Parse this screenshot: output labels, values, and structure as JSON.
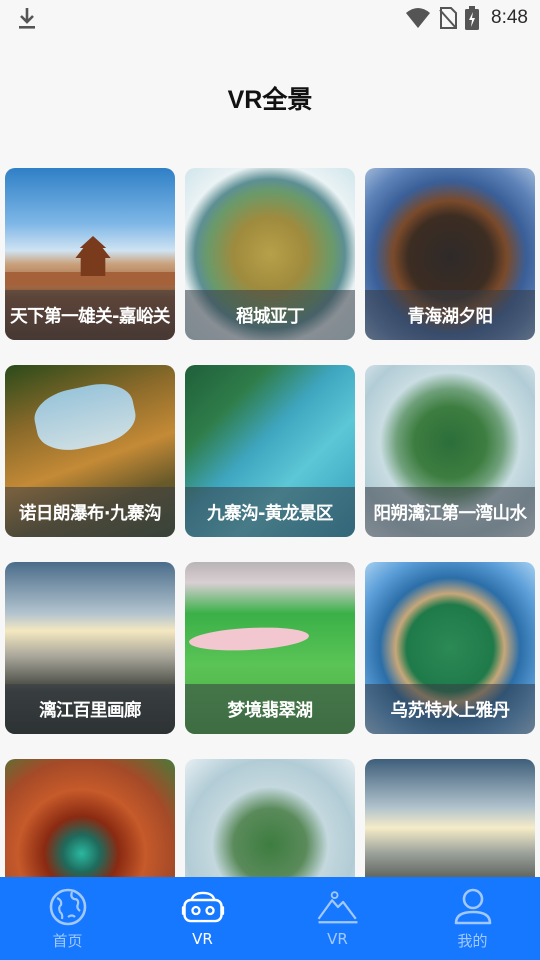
{
  "status_bar": {
    "time": "8:48"
  },
  "header": {
    "title": "VR全景"
  },
  "cards": [
    {
      "title": "天下第一雄关-嘉峪关"
    },
    {
      "title": "稻城亚丁"
    },
    {
      "title": "青海湖夕阳"
    },
    {
      "title": "诺日朗瀑布·九寨沟"
    },
    {
      "title": "九寨沟-黄龙景区"
    },
    {
      "title": "阳朔漓江第一湾山水"
    },
    {
      "title": "漓江百里画廊"
    },
    {
      "title": "梦境翡翠湖"
    },
    {
      "title": "乌苏特水上雅丹"
    },
    {
      "title": ""
    },
    {
      "title": ""
    },
    {
      "title": ""
    }
  ],
  "tabs": [
    {
      "label": "首页",
      "icon": "globe-icon",
      "active": false
    },
    {
      "label": "VR",
      "icon": "vr-headset-icon",
      "active": true
    },
    {
      "label": "VR",
      "icon": "mountain-icon",
      "active": false
    },
    {
      "label": "我的",
      "icon": "person-icon",
      "active": false
    }
  ],
  "colors": {
    "tab_bar": "#1677ff",
    "background": "#f7f7f7"
  }
}
